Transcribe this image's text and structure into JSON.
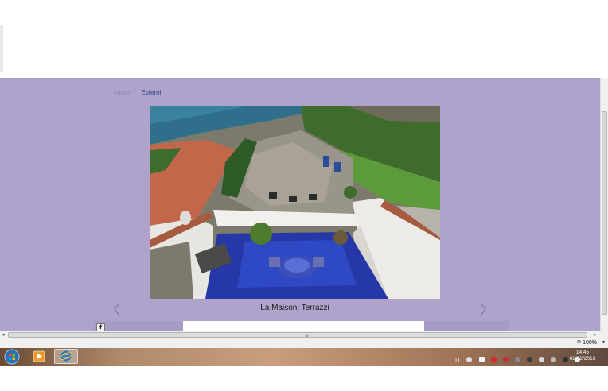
{
  "tabs": [
    {
      "label": "Interni",
      "active": false
    },
    {
      "label": "Esterni",
      "active": true
    }
  ],
  "photo": {
    "caption": "La Maison: Terrazzi"
  },
  "social": {
    "facebook_glyph": "f"
  },
  "statusbar": {
    "zoom": "100%"
  },
  "tray": {
    "language": "IT"
  },
  "clock": {
    "time": "14:45",
    "date": "02/02/2013"
  },
  "icons": {
    "prev": "chevron-left-icon",
    "next": "chevron-right-icon",
    "start": "windows-start-icon",
    "browser": "internet-explorer-icon",
    "media": "media-player-icon",
    "zoom": "magnifier-icon"
  },
  "colors": {
    "page_bg": "#b0a3cb",
    "tab_active": "#2d4b86",
    "tab_inactive": "#8b7fb0"
  }
}
